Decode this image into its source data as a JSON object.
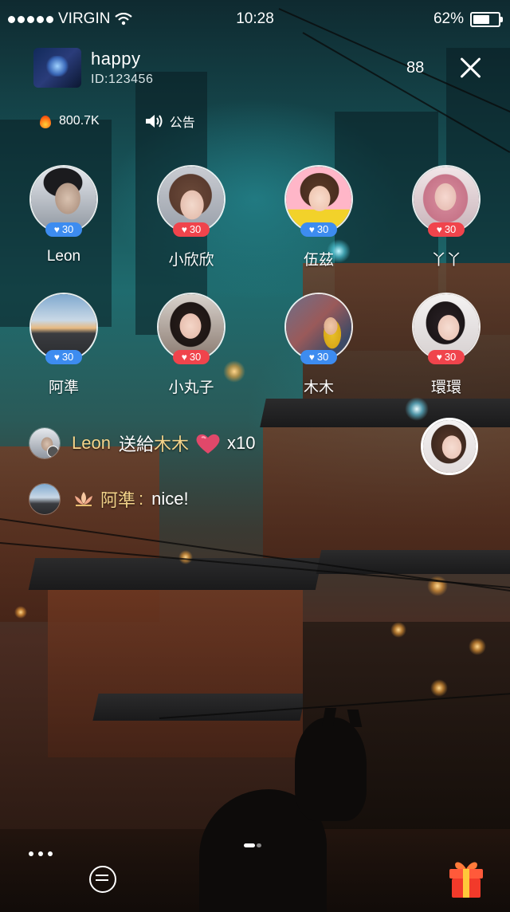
{
  "status_bar": {
    "carrier": "VIRGIN",
    "time": "10:28",
    "battery": "62%"
  },
  "host": {
    "name": "happy",
    "id": "ID:123456",
    "viewers": "88",
    "heat": "800.7K",
    "notice_label": "公告"
  },
  "seats": [
    {
      "name": "Leon",
      "score": "30",
      "badge_color": "#3d8cf0"
    },
    {
      "name": "小欣欣",
      "score": "30",
      "badge_color": "#f0444c"
    },
    {
      "name": "伍茲",
      "score": "30",
      "badge_color": "#3d8cf0"
    },
    {
      "name": "丫丫",
      "score": "30",
      "badge_color": "#f0444c"
    },
    {
      "name": "阿準",
      "score": "30",
      "badge_color": "#3d8cf0"
    },
    {
      "name": "小丸子",
      "score": "30",
      "badge_color": "#f0444c"
    },
    {
      "name": "木木",
      "score": "30",
      "badge_color": "#3d8cf0"
    },
    {
      "name": "環環",
      "score": "30",
      "badge_color": "#f0444c"
    }
  ],
  "chat": [
    {
      "sender": "Leon",
      "action": "送給",
      "target": "木木",
      "gift_icon": "heart-icon",
      "count": "x10"
    },
    {
      "sender": "阿準",
      "separator": ":",
      "message": "nice!",
      "badge_icon": "lotus-icon"
    }
  ],
  "icons": {
    "heat": "flame-icon",
    "notice": "speaker-icon",
    "close": "close-icon",
    "more": "more-dots-icon",
    "chat": "chat-bubble-icon",
    "gift": "gift-icon"
  },
  "colors": {
    "accent_gold": "#f4d48a",
    "badge_blue": "#3d8cf0",
    "badge_red": "#f0444c"
  }
}
